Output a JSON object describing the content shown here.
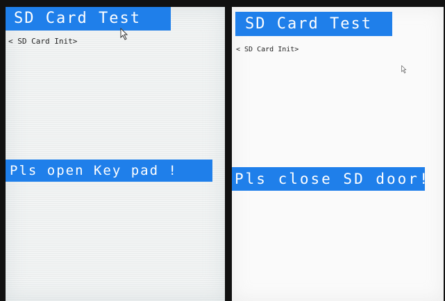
{
  "screens": [
    {
      "title": "SD Card Test",
      "subtitle": "< SD Card Init>",
      "message": "Pls open Key pad !",
      "cursor_icon": "mouse-pointer-icon"
    },
    {
      "title": "SD Card Test",
      "subtitle": "< SD Card Init>",
      "message": "Pls close SD door!",
      "cursor_icon": "mouse-pointer-icon"
    }
  ],
  "colors": {
    "highlight": "#1f7fea",
    "highlight_text": "#ffffff",
    "text": "#222222",
    "bezel": "#111111"
  }
}
